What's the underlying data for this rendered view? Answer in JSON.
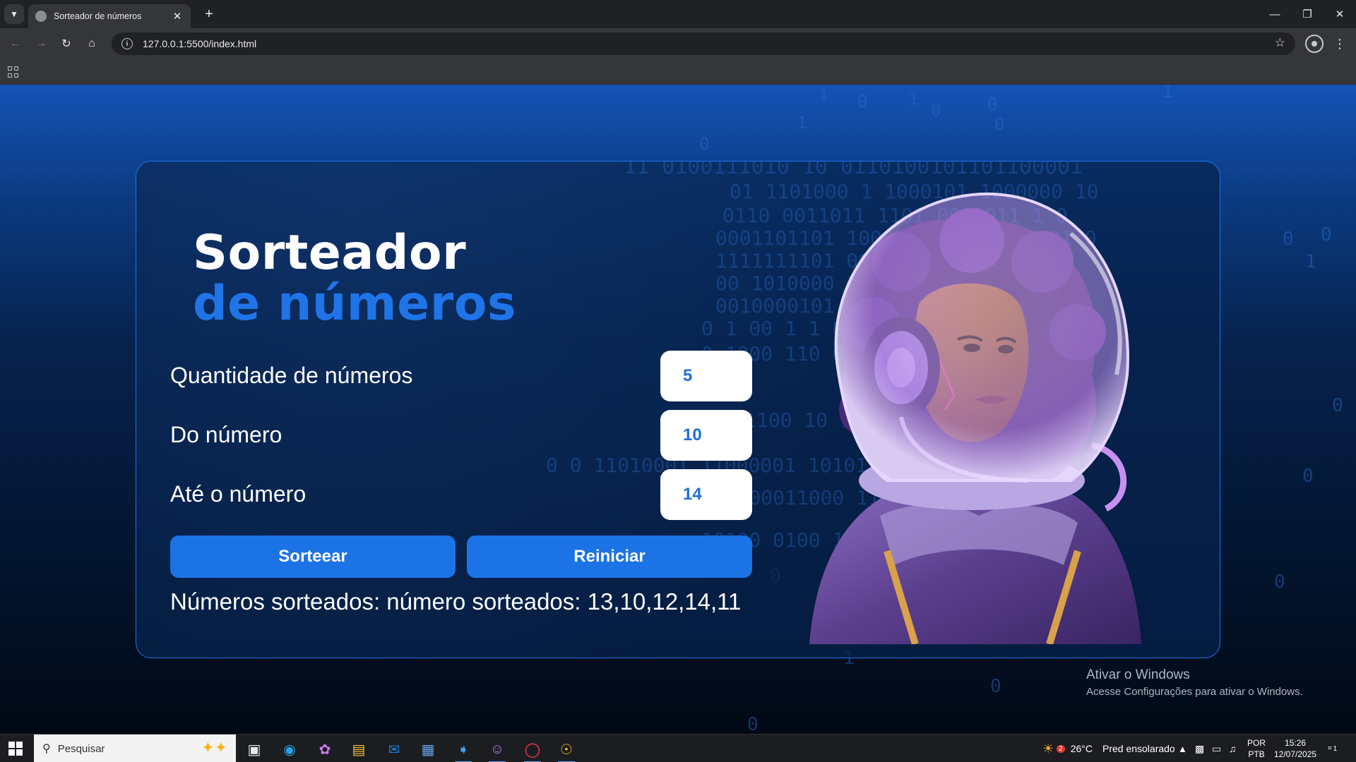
{
  "browser": {
    "tab_title": "Sorteador de números",
    "url": "127.0.0.1:5500/index.html",
    "tab_list_icon": "chevron-down-icon",
    "new_tab_symbol": "+",
    "close_symbol": "✕"
  },
  "app": {
    "title_line1": "Sorteador",
    "title_line2": "de números",
    "fields": [
      {
        "label": "Quantidade de números",
        "value": "5"
      },
      {
        "label": "Do número",
        "value": "10"
      },
      {
        "label": "Até o número",
        "value": "14"
      }
    ],
    "buttons": {
      "draw": "Sorteear",
      "reset": "Reiniciar"
    },
    "result": "Números sorteados: número sorteados: 13,10,12,14,11",
    "accent_color": "#1c73e6"
  },
  "watermark": {
    "line1": "Ativar o Windows",
    "line2": "Acesse Configurações para ativar o Windows."
  },
  "taskbar": {
    "search_placeholder": "Pesquisar",
    "weather_temp": "26°C",
    "weather_text": "Pred ensolarado",
    "weather_badge": "2",
    "lang_line1": "POR",
    "lang_line2": "PTB",
    "time": "15:26",
    "date": "12/07/2025",
    "notification_count": "1"
  }
}
